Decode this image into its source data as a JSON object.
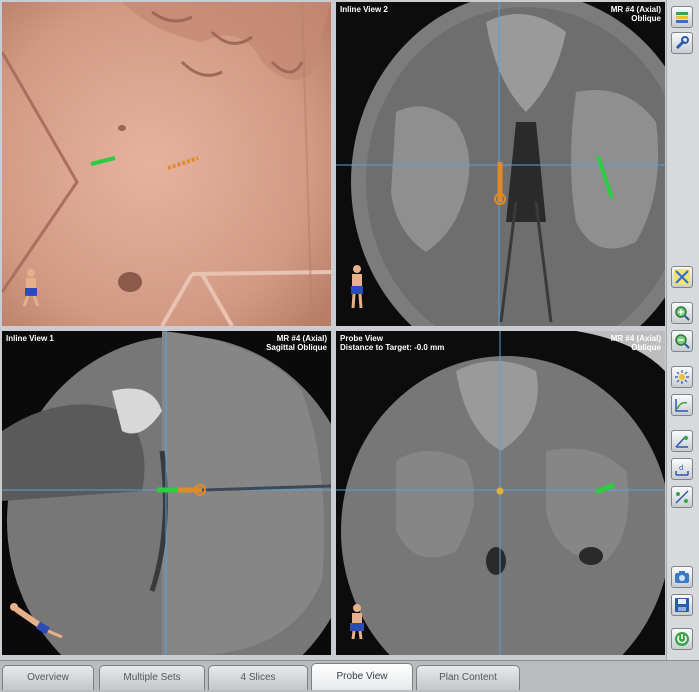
{
  "viewports": {
    "view3d": {
      "title": "",
      "info": []
    },
    "inline2": {
      "title": "Inline View 2",
      "info": [
        "MR #4 (Axial)",
        "Oblique"
      ]
    },
    "inline1": {
      "title": "Inline View 1",
      "info": [
        "MR #4 (Axial)",
        "Sagittal Oblique"
      ]
    },
    "probe": {
      "title": "Probe View",
      "subtitle": "Distance to Target: -0.0 mm",
      "info": [
        "MR #4 (Axial)",
        "Oblique"
      ]
    }
  },
  "tabs": [
    "Overview",
    "Multiple Sets",
    "4 Slices",
    "Probe View",
    "Plan Content"
  ],
  "active_tab": "Probe View",
  "toolbar": {
    "top": [
      "layers-icon",
      "wrench-icon"
    ],
    "middle": [
      "crosshair-icon",
      "zoom-in-icon",
      "zoom-out-icon",
      "brightness-icon",
      "window-level-icon",
      "measure-angle-icon",
      "measure-distance-icon",
      "measure-ratio-icon"
    ],
    "bottom": [
      "camera-icon",
      "save-icon",
      "power-icon"
    ]
  },
  "colors": {
    "probe": "#e08a2a",
    "trajectory": "#2ecc40",
    "crosshair": "#5aa0d8",
    "skin": "#d9a08a"
  }
}
